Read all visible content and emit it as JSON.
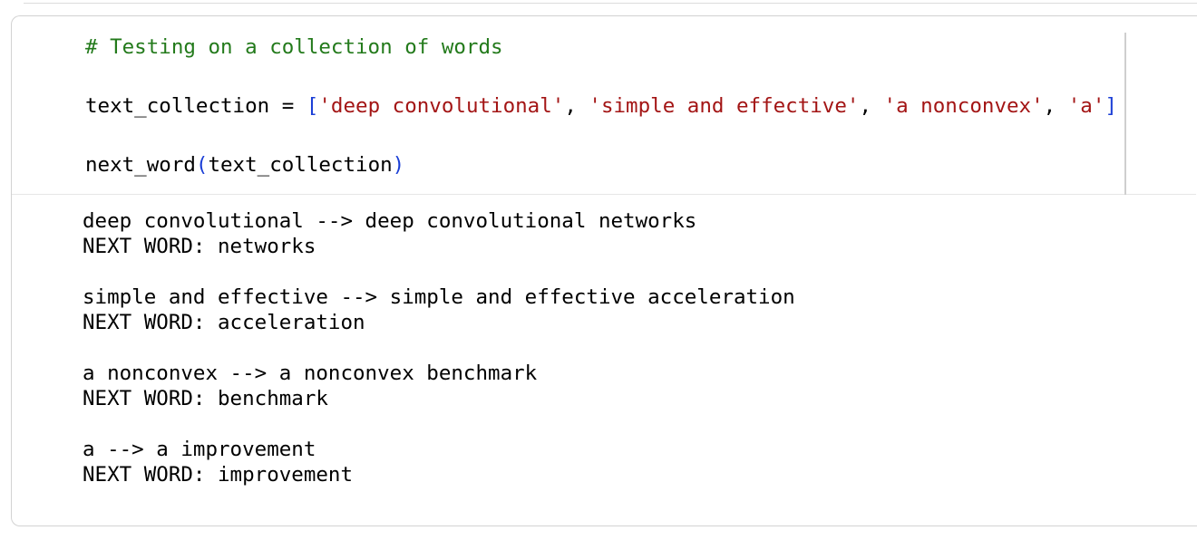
{
  "input": {
    "comment": "# Testing on a collection of words",
    "assign": {
      "var": "text_collection",
      "op": " = ",
      "open": "[",
      "items": [
        "'deep convolutional'",
        "'simple and effective'",
        "'a nonconvex'",
        "'a'"
      ],
      "sep": ", ",
      "close": "]"
    },
    "call": {
      "func": "next_word",
      "open": "(",
      "arg": "text_collection",
      "close": ")"
    }
  },
  "output": {
    "lines": [
      "deep convolutional --> deep convolutional networks",
      "NEXT WORD: networks",
      "",
      "simple and effective --> simple and effective acceleration",
      "NEXT WORD: acceleration",
      "",
      "a nonconvex --> a nonconvex benchmark",
      "NEXT WORD: benchmark",
      "",
      "a --> a improvement",
      "NEXT WORD: improvement"
    ]
  },
  "colors": {
    "comment": "#237a1b",
    "string": "#a31515",
    "bracket": "#1a3ed6"
  }
}
